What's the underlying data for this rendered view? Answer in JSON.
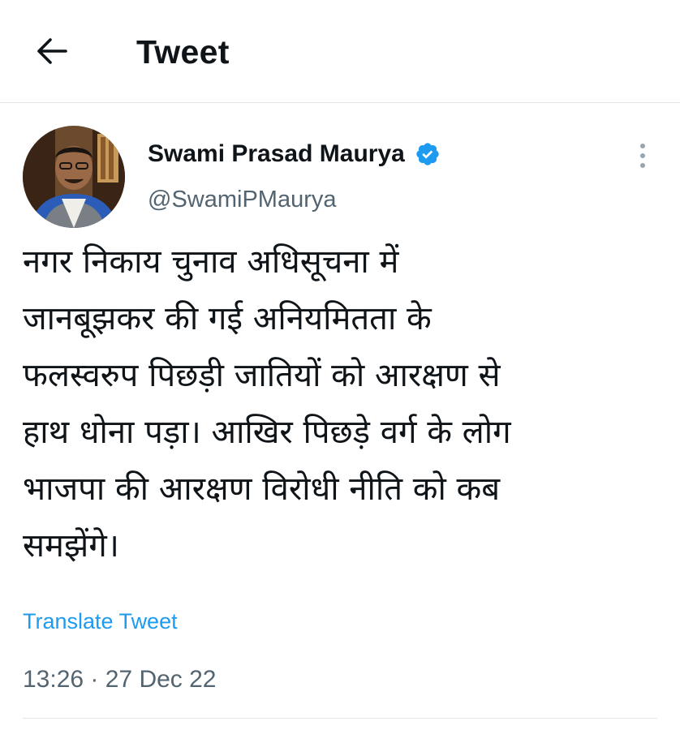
{
  "header": {
    "title": "Tweet",
    "back_icon": "arrow-left-icon"
  },
  "tweet": {
    "author": {
      "name": "Swami Prasad Maurya",
      "handle": "@SwamiPMaurya",
      "verified": true,
      "verified_color": "#1d9bf0"
    },
    "text_lines": [
      "नगर निकाय चुनाव अधिसूचना में",
      "जानबूझकर की गई अनियमितता के",
      "फलस्वरुप पिछड़ी जातियों को आरक्षण से",
      "हाथ धोना पड़ा। आखिर पिछड़े वर्ग के लोग",
      "भाजपा की आरक्षण विरोधी नीति को कब",
      "समझेंगे।"
    ],
    "translate_label": "Translate Tweet",
    "timestamp": "13:26 · 27 Dec 22"
  },
  "colors": {
    "accent": "#1d9bf0",
    "text": "#0f1419",
    "secondary_text": "#536471",
    "divider": "#e1e6ea"
  }
}
